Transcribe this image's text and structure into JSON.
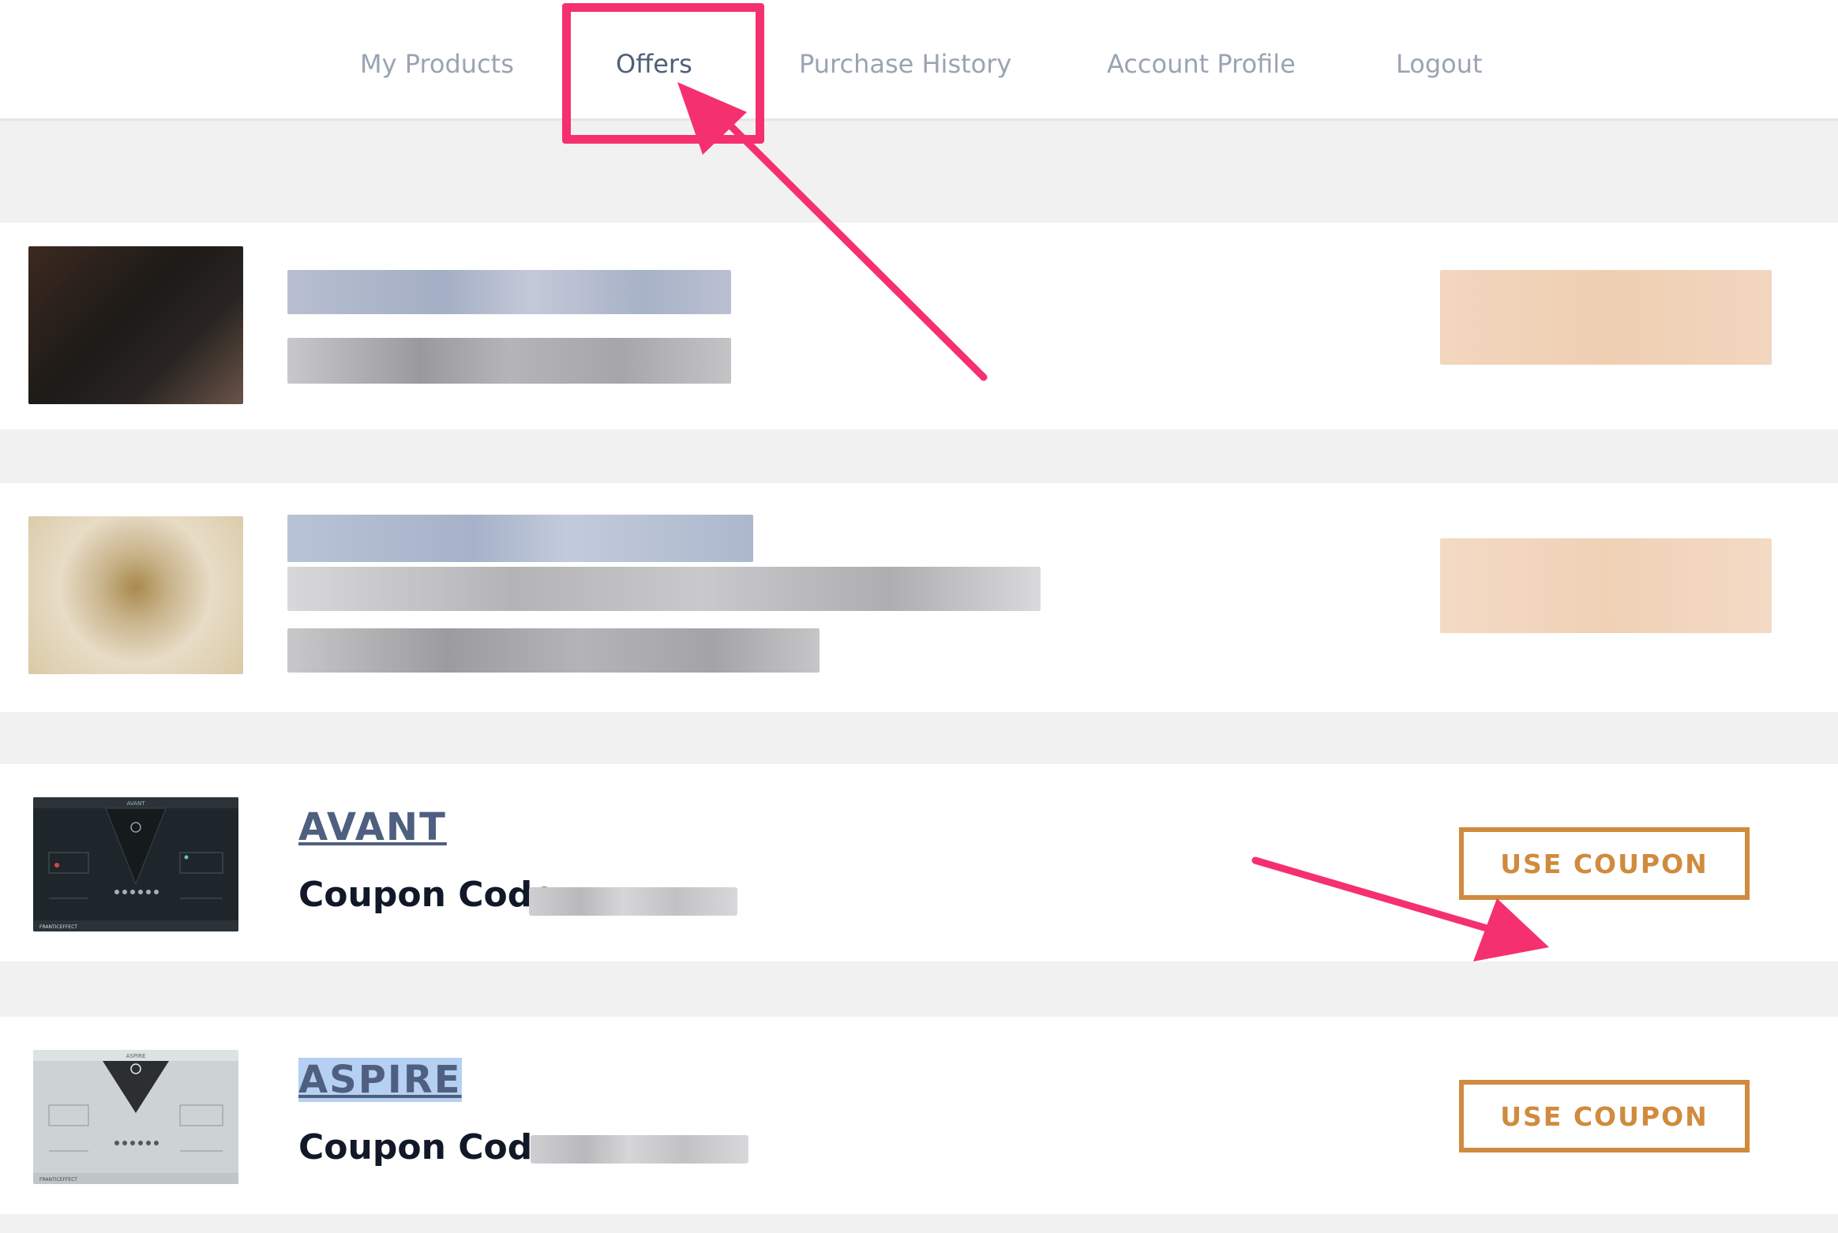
{
  "nav": {
    "items": [
      {
        "label": "My Products"
      },
      {
        "label": "Offers"
      },
      {
        "label": "Purchase History"
      },
      {
        "label": "Account Profile"
      },
      {
        "label": "Logout"
      }
    ],
    "active": "Offers"
  },
  "offers": [
    {
      "title": "AVANT",
      "coupon_label": "Coupon Code:",
      "button_label": "USE COUPON",
      "thumbnail_title": "AVANT",
      "thumbnail_brand": "FRANTICEFFECT"
    },
    {
      "title": "ASPIRE",
      "coupon_label": "Coupon Code:",
      "button_label": "USE COUPON",
      "thumbnail_title": "ASPIRE",
      "thumbnail_brand": "FRANTICEFFECT"
    }
  ],
  "colors": {
    "annotation": "#f5306f",
    "accent": "#d08b3e",
    "title_link": "#4f5f80",
    "nav_text": "#9aa4b2",
    "nav_active": "#4f5f78"
  },
  "icons": [
    "annotation-arrow-icon"
  ]
}
